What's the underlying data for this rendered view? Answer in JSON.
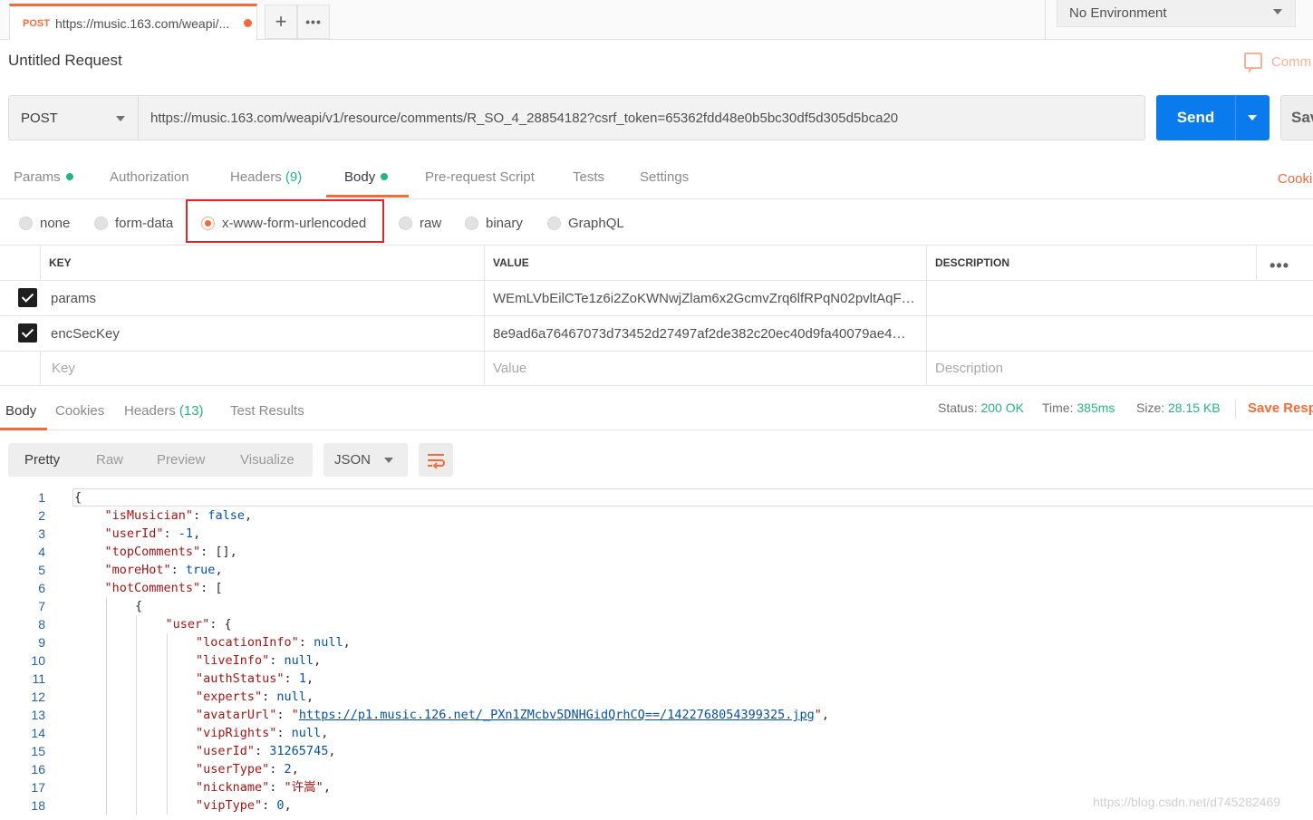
{
  "tabs_bar": {
    "request_tab": {
      "method": "POST",
      "title": "https://music.163.com/weapi/..."
    },
    "new_tab_label": "+",
    "more_label": "•••",
    "environment": "No Environment"
  },
  "request": {
    "title": "Untitled Request",
    "comments_label": "Comm",
    "method": "POST",
    "url": "https://music.163.com/weapi/v1/resource/comments/R_SO_4_28854182?csrf_token=65362fdd48e0b5bc30df5d305d5bca20",
    "send_label": "Send",
    "save_label": "Save"
  },
  "request_tabs": [
    {
      "label": "Params",
      "dot": true
    },
    {
      "label": "Authorization"
    },
    {
      "label": "Headers",
      "count": "(9)"
    },
    {
      "label": "Body",
      "dot": true,
      "active": true
    },
    {
      "label": "Pre-request Script"
    },
    {
      "label": "Tests"
    },
    {
      "label": "Settings"
    }
  ],
  "cookies_label": "Cookies",
  "body_types": [
    "none",
    "form-data",
    "x-www-form-urlencoded",
    "raw",
    "binary",
    "GraphQL"
  ],
  "body_type_selected": "x-www-form-urlencoded",
  "kv_table": {
    "headers": [
      "KEY",
      "VALUE",
      "DESCRIPTION"
    ],
    "rows": [
      {
        "key": "params",
        "value": "WEmLVbEilCTe1z6i2ZoKWNwjZlam6x2GcmvZrq6lfRPqN02pvltAqF…",
        "checked": true
      },
      {
        "key": "encSecKey",
        "value": "8e9ad6a76467073d73452d27497af2de382c20ec40d9fa40079ae4…",
        "checked": true
      }
    ],
    "placeholders": {
      "key": "Key",
      "value": "Value",
      "description": "Description"
    }
  },
  "response_tabs": [
    {
      "label": "Body",
      "active": true
    },
    {
      "label": "Cookies"
    },
    {
      "label": "Headers",
      "count": "(13)"
    },
    {
      "label": "Test Results"
    }
  ],
  "response_status": {
    "status_label": "Status:",
    "status_value": "200 OK",
    "time_label": "Time:",
    "time_value": "385ms",
    "size_label": "Size:",
    "size_value": "28.15 KB",
    "save_label": "Save Resp"
  },
  "viewer": {
    "modes": [
      "Pretty",
      "Raw",
      "Preview",
      "Visualize"
    ],
    "active_mode": "Pretty",
    "format": "JSON"
  },
  "code_lines": [
    {
      "n": "1",
      "indent": 0,
      "parts": [
        [
          "p",
          "{"
        ]
      ]
    },
    {
      "n": "2",
      "indent": 1,
      "parts": [
        [
          "k",
          "\"isMusician\""
        ],
        [
          "p",
          ": "
        ],
        [
          "l",
          "false"
        ],
        [
          "p",
          ","
        ]
      ]
    },
    {
      "n": "3",
      "indent": 1,
      "parts": [
        [
          "k",
          "\"userId\""
        ],
        [
          "p",
          ": "
        ],
        [
          "l",
          "-1"
        ],
        [
          "p",
          ","
        ]
      ]
    },
    {
      "n": "4",
      "indent": 1,
      "parts": [
        [
          "k",
          "\"topComments\""
        ],
        [
          "p",
          ": [],"
        ]
      ]
    },
    {
      "n": "5",
      "indent": 1,
      "parts": [
        [
          "k",
          "\"moreHot\""
        ],
        [
          "p",
          ": "
        ],
        [
          "l",
          "true"
        ],
        [
          "p",
          ","
        ]
      ]
    },
    {
      "n": "6",
      "indent": 1,
      "parts": [
        [
          "k",
          "\"hotComments\""
        ],
        [
          "p",
          ": ["
        ]
      ]
    },
    {
      "n": "7",
      "indent": 2,
      "parts": [
        [
          "p",
          "{"
        ]
      ]
    },
    {
      "n": "8",
      "indent": 3,
      "parts": [
        [
          "k",
          "\"user\""
        ],
        [
          "p",
          ": {"
        ]
      ]
    },
    {
      "n": "9",
      "indent": 4,
      "parts": [
        [
          "k",
          "\"locationInfo\""
        ],
        [
          "p",
          ": "
        ],
        [
          "l",
          "null"
        ],
        [
          "p",
          ","
        ]
      ]
    },
    {
      "n": "10",
      "indent": 4,
      "parts": [
        [
          "k",
          "\"liveInfo\""
        ],
        [
          "p",
          ": "
        ],
        [
          "l",
          "null"
        ],
        [
          "p",
          ","
        ]
      ]
    },
    {
      "n": "11",
      "indent": 4,
      "parts": [
        [
          "k",
          "\"authStatus\""
        ],
        [
          "p",
          ": "
        ],
        [
          "l",
          "1"
        ],
        [
          "p",
          ","
        ]
      ]
    },
    {
      "n": "12",
      "indent": 4,
      "parts": [
        [
          "k",
          "\"experts\""
        ],
        [
          "p",
          ": "
        ],
        [
          "l",
          "null"
        ],
        [
          "p",
          ","
        ]
      ]
    },
    {
      "n": "13",
      "indent": 4,
      "parts": [
        [
          "k",
          "\"avatarUrl\""
        ],
        [
          "p",
          ": "
        ],
        [
          "s",
          "\""
        ],
        [
          "u",
          "https://p1.music.126.net/_PXn1ZMcbv5DNHGidQrhCQ==/1422768054399325.jpg"
        ],
        [
          "s",
          "\""
        ],
        [
          "p",
          ","
        ]
      ]
    },
    {
      "n": "14",
      "indent": 4,
      "parts": [
        [
          "k",
          "\"vipRights\""
        ],
        [
          "p",
          ": "
        ],
        [
          "l",
          "null"
        ],
        [
          "p",
          ","
        ]
      ]
    },
    {
      "n": "15",
      "indent": 4,
      "parts": [
        [
          "k",
          "\"userId\""
        ],
        [
          "p",
          ": "
        ],
        [
          "l",
          "31265745"
        ],
        [
          "p",
          ","
        ]
      ]
    },
    {
      "n": "16",
      "indent": 4,
      "parts": [
        [
          "k",
          "\"userType\""
        ],
        [
          "p",
          ": "
        ],
        [
          "l",
          "2"
        ],
        [
          "p",
          ","
        ]
      ]
    },
    {
      "n": "17",
      "indent": 4,
      "parts": [
        [
          "k",
          "\"nickname\""
        ],
        [
          "p",
          ": "
        ],
        [
          "s",
          "\"许嵩\""
        ],
        [
          "p",
          ","
        ]
      ]
    },
    {
      "n": "18",
      "indent": 4,
      "parts": [
        [
          "k",
          "\"vipType\""
        ],
        [
          "p",
          ": "
        ],
        [
          "l",
          "0"
        ],
        [
          "p",
          ","
        ]
      ]
    }
  ],
  "watermark": "https://blog.csdn.net/d745282469",
  "colors": {
    "accent": "#f26b3a",
    "send": "#097bed",
    "success": "#26b47f",
    "highlight": "#e0242b"
  }
}
